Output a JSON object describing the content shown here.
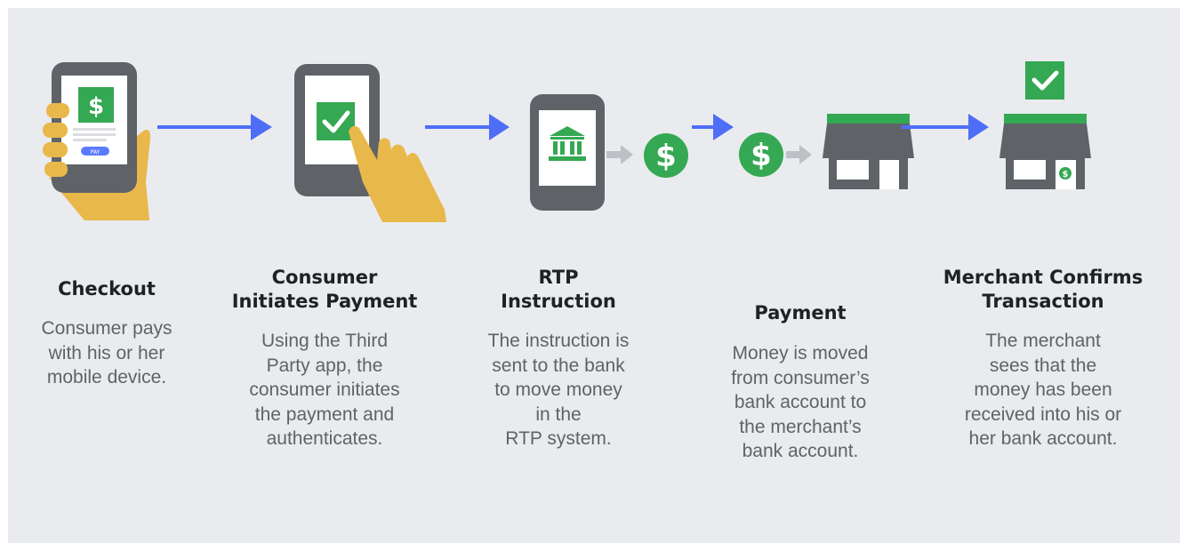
{
  "colors": {
    "background": "#e9ebee",
    "phone": "#5f6368",
    "green": "#34a853",
    "arrow_blue": "#4f6ef7",
    "arrow_grey": "#bdc1c6",
    "hand": "#e8b84a",
    "pay_button": "#5b7bff",
    "title_text": "#202124",
    "body_text": "#5f6368"
  },
  "icons": {
    "checkout": "phone-in-hand-dollar-icon",
    "initiate": "phone-tap-check-icon",
    "rtp": "phone-bank-icon",
    "payment": "dollar-coin-to-store-icon",
    "confirm": "store-check-dollar-icon"
  },
  "pay_button_label": "PAY",
  "steps": [
    {
      "title": "Checkout",
      "description": "Consumer pays\nwith his or her\nmobile device."
    },
    {
      "title": "Consumer\nInitiates Payment",
      "description": "Using the Third\nParty app, the\nconsumer initiates\nthe payment and\nauthenticates."
    },
    {
      "title": "RTP\nInstruction",
      "description": "The instruction is\nsent to the bank\nto move money\nin the\nRTP system."
    },
    {
      "title": "Payment",
      "description": "Money is moved\nfrom consumer’s\nbank account to\nthe merchant’s\nbank account."
    },
    {
      "title": "Merchant Confirms\nTransaction",
      "description": "The merchant\nsees that the\nmoney has been\nreceived into his or\nher bank account."
    }
  ]
}
